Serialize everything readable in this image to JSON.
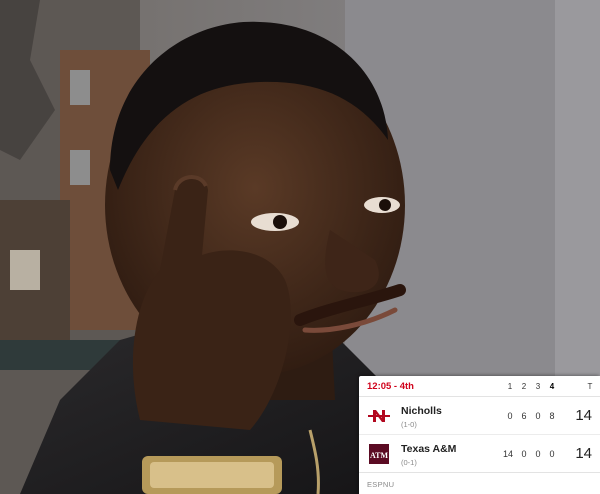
{
  "colors": {
    "clock_red": "#d0021b",
    "nicholls_red": "#b2081f",
    "texas_am_maroon": "#5b0b23",
    "card_bg": "#ffffff"
  },
  "photo": {
    "description_icon": "thinking-man-photo"
  },
  "scoreboard": {
    "game_clock": "12:05 - 4th",
    "quarter_headers": [
      "1",
      "2",
      "3",
      "4"
    ],
    "total_header": "T",
    "current_quarter_index": 3,
    "teams": [
      {
        "name": "Nicholls",
        "record": "(1-0)",
        "logo_icon": "nicholls-logo-icon",
        "logo_text": "N",
        "quarters": [
          "0",
          "6",
          "0",
          "8"
        ],
        "total": "14"
      },
      {
        "name": "Texas A&M",
        "record": "(0-1)",
        "logo_icon": "texas-am-logo-icon",
        "logo_text": "ATM",
        "quarters": [
          "14",
          "0",
          "0",
          "0"
        ],
        "total": "14"
      }
    ],
    "network": "ESPNU"
  }
}
